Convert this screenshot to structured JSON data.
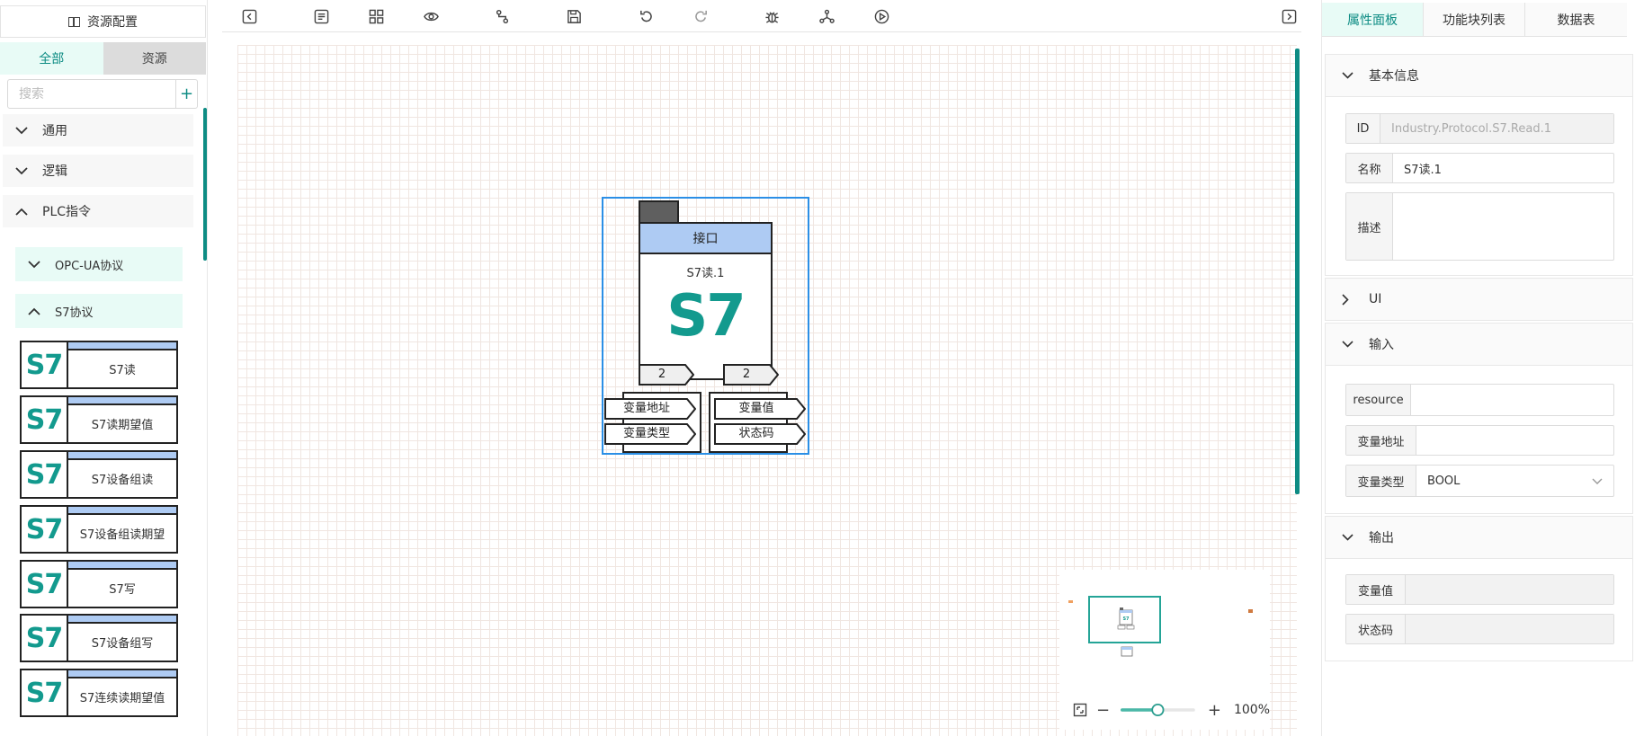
{
  "left": {
    "header": "资源配置",
    "tabs": [
      "全部",
      "资源"
    ],
    "search_placeholder": "搜索",
    "add": "+",
    "categories": [
      "通用",
      "逻辑",
      "PLC指令"
    ],
    "subcategories": [
      "OPC-UA协议",
      "S7协议"
    ],
    "logo": "S7",
    "items": [
      "S7读",
      "S7读期望值",
      "S7设备组读",
      "S7设备组读期望",
      "S7写",
      "S7设备组写",
      "S7连续读期望值"
    ]
  },
  "toolbar": {
    "icons": [
      "collapse-left-icon",
      "list-icon",
      "layout-icon",
      "eye-icon",
      "route-icon",
      "save-icon",
      "undo-icon",
      "redo-icon",
      "bug-icon",
      "network-icon",
      "play-icon",
      "collapse-right-icon"
    ]
  },
  "node": {
    "header": "接口",
    "name": "S7读.1",
    "logo": "S7",
    "pin_counts": [
      "2",
      "2"
    ],
    "inputs": [
      "变量地址",
      "变量类型"
    ],
    "outputs": [
      "变量值",
      "状态码"
    ]
  },
  "minimap": {
    "zoom": "100%",
    "minus": "−",
    "plus": "+",
    "zoom_level": 0.5
  },
  "right": {
    "tabs": [
      "属性面板",
      "功能块列表",
      "数据表"
    ],
    "sections": {
      "basic": "基本信息",
      "ui": "UI",
      "input": "输入",
      "output": "输出"
    },
    "basic": {
      "id_label": "ID",
      "id_value": "Industry.Protocol.S7.Read.1",
      "name_label": "名称",
      "name_value": "S7读.1",
      "desc_label": "描述",
      "desc_value": ""
    },
    "input": {
      "resource_label": "resource",
      "resource_value": "",
      "addr_label": "变量地址",
      "addr_value": "",
      "type_label": "变量类型",
      "type_value": "BOOL"
    },
    "output": {
      "value_label": "变量值",
      "status_label": "状态码"
    }
  },
  "colors": {
    "accent": "#0e8c84",
    "selection": "#2b8fe6",
    "node_header": "#aecbf3",
    "logo": "#139a8e"
  }
}
